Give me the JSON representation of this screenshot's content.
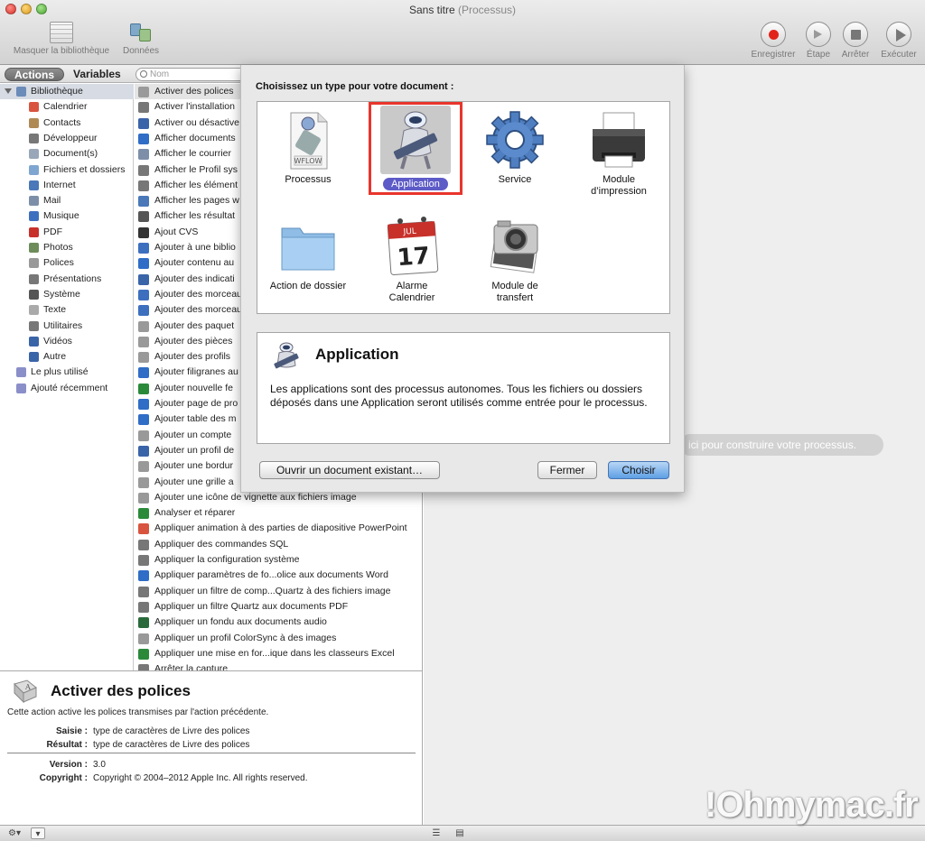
{
  "window": {
    "title": "Sans titre",
    "subtitle": "(Processus)"
  },
  "toolbar": {
    "hide_library": "Masquer la bibliothèque",
    "data": "Données",
    "record": "Enregistrer",
    "step": "Étape",
    "stop": "Arrêter",
    "run": "Exécuter"
  },
  "library_header": {
    "tab_actions": "Actions",
    "tab_variables": "Variables",
    "search_placeholder": "Nom"
  },
  "categories": [
    {
      "label": "Bibliothèque",
      "color": "#6b8bb8"
    },
    {
      "label": "Calendrier",
      "color": "#d9543f"
    },
    {
      "label": "Contacts",
      "color": "#b08a55"
    },
    {
      "label": "Développeur",
      "color": "#777777"
    },
    {
      "label": "Document(s)",
      "color": "#9aa7b8"
    },
    {
      "label": "Fichiers et dossiers",
      "color": "#7fa6d0"
    },
    {
      "label": "Internet",
      "color": "#4a78b8"
    },
    {
      "label": "Mail",
      "color": "#7d8fa8"
    },
    {
      "label": "Musique",
      "color": "#3d6fbf"
    },
    {
      "label": "PDF",
      "color": "#c8302a"
    },
    {
      "label": "Photos",
      "color": "#6d8c5a"
    },
    {
      "label": "Polices",
      "color": "#999999"
    },
    {
      "label": "Présentations",
      "color": "#777777"
    },
    {
      "label": "Système",
      "color": "#555555"
    },
    {
      "label": "Texte",
      "color": "#aaaaaa"
    },
    {
      "label": "Utilitaires",
      "color": "#777777"
    },
    {
      "label": "Vidéos",
      "color": "#3a64a8"
    },
    {
      "label": "Autre",
      "color": "#3a64a8"
    },
    {
      "label": "Le plus utilisé",
      "color": "#8a8fc9"
    },
    {
      "label": "Ajouté récemment",
      "color": "#8a8fc9"
    }
  ],
  "actions": [
    {
      "label": "Activer des polices",
      "color": "#9a9a9a"
    },
    {
      "label": "Activer l'installation",
      "color": "#777777"
    },
    {
      "label": "Activer ou désactive",
      "color": "#3a64a8"
    },
    {
      "label": "Afficher documents",
      "color": "#2f6dc6"
    },
    {
      "label": "Afficher le courrier",
      "color": "#7d8fa8"
    },
    {
      "label": "Afficher le Profil sys",
      "color": "#777777"
    },
    {
      "label": "Afficher les élément",
      "color": "#777777"
    },
    {
      "label": "Afficher les pages w",
      "color": "#4a78b8"
    },
    {
      "label": "Afficher les résultat",
      "color": "#555555"
    },
    {
      "label": "Ajout CVS",
      "color": "#333333"
    },
    {
      "label": "Ajouter à une biblio",
      "color": "#3d6fbf"
    },
    {
      "label": "Ajouter contenu au",
      "color": "#2f6dc6"
    },
    {
      "label": "Ajouter des indicati",
      "color": "#3a64a8"
    },
    {
      "label": "Ajouter des morceau",
      "color": "#3d6fbf"
    },
    {
      "label": "Ajouter des morceau",
      "color": "#3d6fbf"
    },
    {
      "label": "Ajouter des paquet",
      "color": "#999999"
    },
    {
      "label": "Ajouter des pièces",
      "color": "#999999"
    },
    {
      "label": "Ajouter des profils",
      "color": "#999999"
    },
    {
      "label": "Ajouter filigranes au",
      "color": "#2f6dc6"
    },
    {
      "label": "Ajouter nouvelle fe",
      "color": "#2a8a3a"
    },
    {
      "label": "Ajouter page de pro",
      "color": "#2f6dc6"
    },
    {
      "label": "Ajouter table des m",
      "color": "#2f6dc6"
    },
    {
      "label": "Ajouter un compte",
      "color": "#999999"
    },
    {
      "label": "Ajouter un profil de",
      "color": "#3a64a8"
    },
    {
      "label": "Ajouter une bordur",
      "color": "#999999"
    },
    {
      "label": "Ajouter une grille a",
      "color": "#999999"
    },
    {
      "label": "Ajouter une icône de vignette aux fichiers image",
      "color": "#999999"
    },
    {
      "label": "Analyser et réparer",
      "color": "#2a8a3a"
    },
    {
      "label": "Appliquer animation à des parties de diapositive PowerPoint",
      "color": "#d9543f"
    },
    {
      "label": "Appliquer des commandes SQL",
      "color": "#777777"
    },
    {
      "label": "Appliquer la configuration système",
      "color": "#777777"
    },
    {
      "label": "Appliquer paramètres de fo...olice aux documents Word",
      "color": "#2f6dc6"
    },
    {
      "label": "Appliquer un filtre de comp...Quartz à des fichiers image",
      "color": "#777777"
    },
    {
      "label": "Appliquer un filtre Quartz aux documents PDF",
      "color": "#777777"
    },
    {
      "label": "Appliquer un fondu aux documents audio",
      "color": "#2a6a3a"
    },
    {
      "label": "Appliquer un profil ColorSync à des images",
      "color": "#999999"
    },
    {
      "label": "Appliquer une mise en for...ique dans les classeurs Excel",
      "color": "#2a8a3a"
    },
    {
      "label": "Arrêter la capture",
      "color": "#777777"
    }
  ],
  "description": {
    "title": "Activer des polices",
    "text": "Cette action active les polices transmises par l'action précédente.",
    "input_label": "Saisie :",
    "input_value": "type de caractères de Livre des polices",
    "result_label": "Résultat :",
    "result_value": "type de caractères de Livre des polices",
    "version_label": "Version :",
    "version_value": "3.0",
    "copyright_label": "Copyright :",
    "copyright_value": "Copyright © 2004–2012 Apple Inc. All rights reserved."
  },
  "workflow": {
    "drop_hint": "ici pour construire votre processus."
  },
  "sheet": {
    "heading": "Choisissez un type pour votre document :",
    "types": [
      {
        "label": "Processus",
        "icon": "workflow-file-icon",
        "badge": "WFLOW"
      },
      {
        "label": "Application",
        "icon": "automator-robot-icon",
        "selected": true
      },
      {
        "label": "Service",
        "icon": "gear-icon"
      },
      {
        "label": "Module\nd'impression",
        "line1": "Module",
        "line2": "d’impression",
        "icon": "printer-icon"
      },
      {
        "label": "Action de dossier",
        "icon": "folder-icon"
      },
      {
        "label": "Alarme Calendrier",
        "line1": "Alarme",
        "line2": "Calendrier",
        "icon": "calendar-icon",
        "cal_month": "JUL",
        "cal_day": "17"
      },
      {
        "label": "Module de transfert",
        "line1": "Module de",
        "line2": "transfert",
        "icon": "camera-icon"
      }
    ],
    "info_title": "Application",
    "info_body": "Les applications sont des processus autonomes. Tous les fichiers ou dossiers déposés dans une Application seront utilisés comme entrée pour le processus.",
    "open_existing": "Ouvrir un document existant…",
    "close": "Fermer",
    "choose": "Choisir"
  },
  "watermark": "!Ohmymac.fr"
}
